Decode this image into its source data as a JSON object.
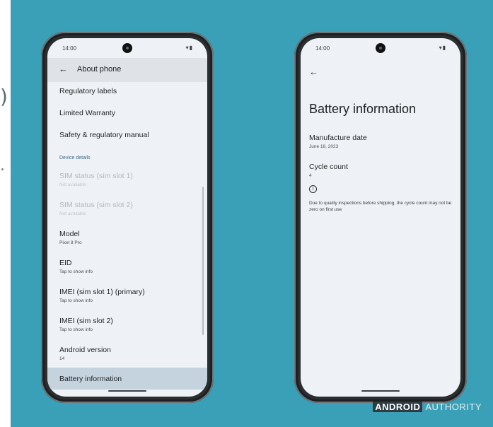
{
  "status": {
    "time": "14:00"
  },
  "left_phone": {
    "title": "About phone",
    "rows_top": [
      {
        "title": "Regulatory labels"
      },
      {
        "title": "Limited Warranty"
      },
      {
        "title": "Safety & regulatory manual"
      }
    ],
    "section_header": "Device details",
    "rows_details": [
      {
        "title": "SIM status (sim slot 1)",
        "subtitle": "Not available",
        "disabled": true
      },
      {
        "title": "SIM status (sim slot 2)",
        "subtitle": "Not available",
        "disabled": true
      },
      {
        "title": "Model",
        "subtitle": "Pixel 8 Pro"
      },
      {
        "title": "EID",
        "subtitle": "Tap to show info"
      },
      {
        "title": "IMEI (sim slot 1) (primary)",
        "subtitle": "Tap to show info"
      },
      {
        "title": "IMEI (sim slot 2)",
        "subtitle": "Tap to show info"
      },
      {
        "title": "Android version",
        "subtitle": "14"
      }
    ],
    "selected_row": "Battery information"
  },
  "right_phone": {
    "title": "Battery information",
    "manufacture_label": "Manufacture date",
    "manufacture_value": "June 18, 2023",
    "cycle_label": "Cycle count",
    "cycle_value": "4",
    "note": "Due to quality inspections before shipping, the cycle count may not be zero on first use"
  },
  "watermark": {
    "part1": "ANDROID",
    "part2": "AUTHORITY"
  },
  "icons": [
    "back-arrow-icon",
    "wifi-icon",
    "battery-icon",
    "info-icon"
  ]
}
